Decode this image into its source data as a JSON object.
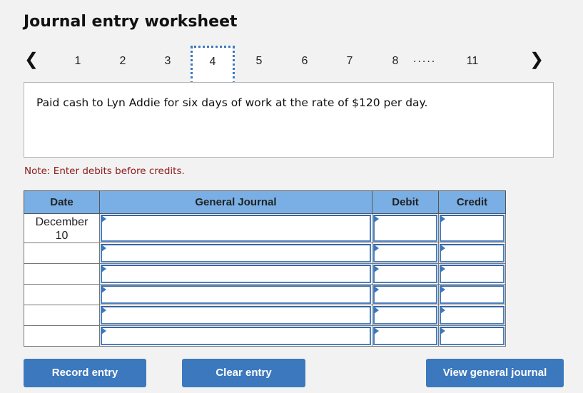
{
  "header": {
    "title": "Journal entry worksheet"
  },
  "pager": {
    "prev_icon": "chevron-left-icon",
    "next_icon": "chevron-right-icon",
    "pages": [
      "1",
      "2",
      "3",
      "4",
      "5",
      "6",
      "7",
      "8",
      "11"
    ],
    "ellipsis": ".....",
    "active_page": "4"
  },
  "prompt": {
    "text": "Paid cash to Lyn Addie for six days of work at the rate of $120 per day."
  },
  "note": "Note: Enter debits before credits.",
  "journal": {
    "columns": [
      "Date",
      "General Journal",
      "Debit",
      "Credit"
    ],
    "rows": [
      {
        "date_line1": "December",
        "date_line2": "10",
        "account": "",
        "debit": "",
        "credit": ""
      },
      {
        "date_line1": "",
        "date_line2": "",
        "account": "",
        "debit": "",
        "credit": ""
      },
      {
        "date_line1": "",
        "date_line2": "",
        "account": "",
        "debit": "",
        "credit": ""
      },
      {
        "date_line1": "",
        "date_line2": "",
        "account": "",
        "debit": "",
        "credit": ""
      },
      {
        "date_line1": "",
        "date_line2": "",
        "account": "",
        "debit": "",
        "credit": ""
      },
      {
        "date_line1": "",
        "date_line2": "",
        "account": "",
        "debit": "",
        "credit": ""
      }
    ]
  },
  "buttons": {
    "record": "Record entry",
    "clear": "Clear entry",
    "view": "View general journal"
  },
  "colors": {
    "accent": "#3c78bd",
    "header_bg": "#7aafe5",
    "note": "#8b1a1a",
    "page_bg": "#f2f2f2"
  }
}
